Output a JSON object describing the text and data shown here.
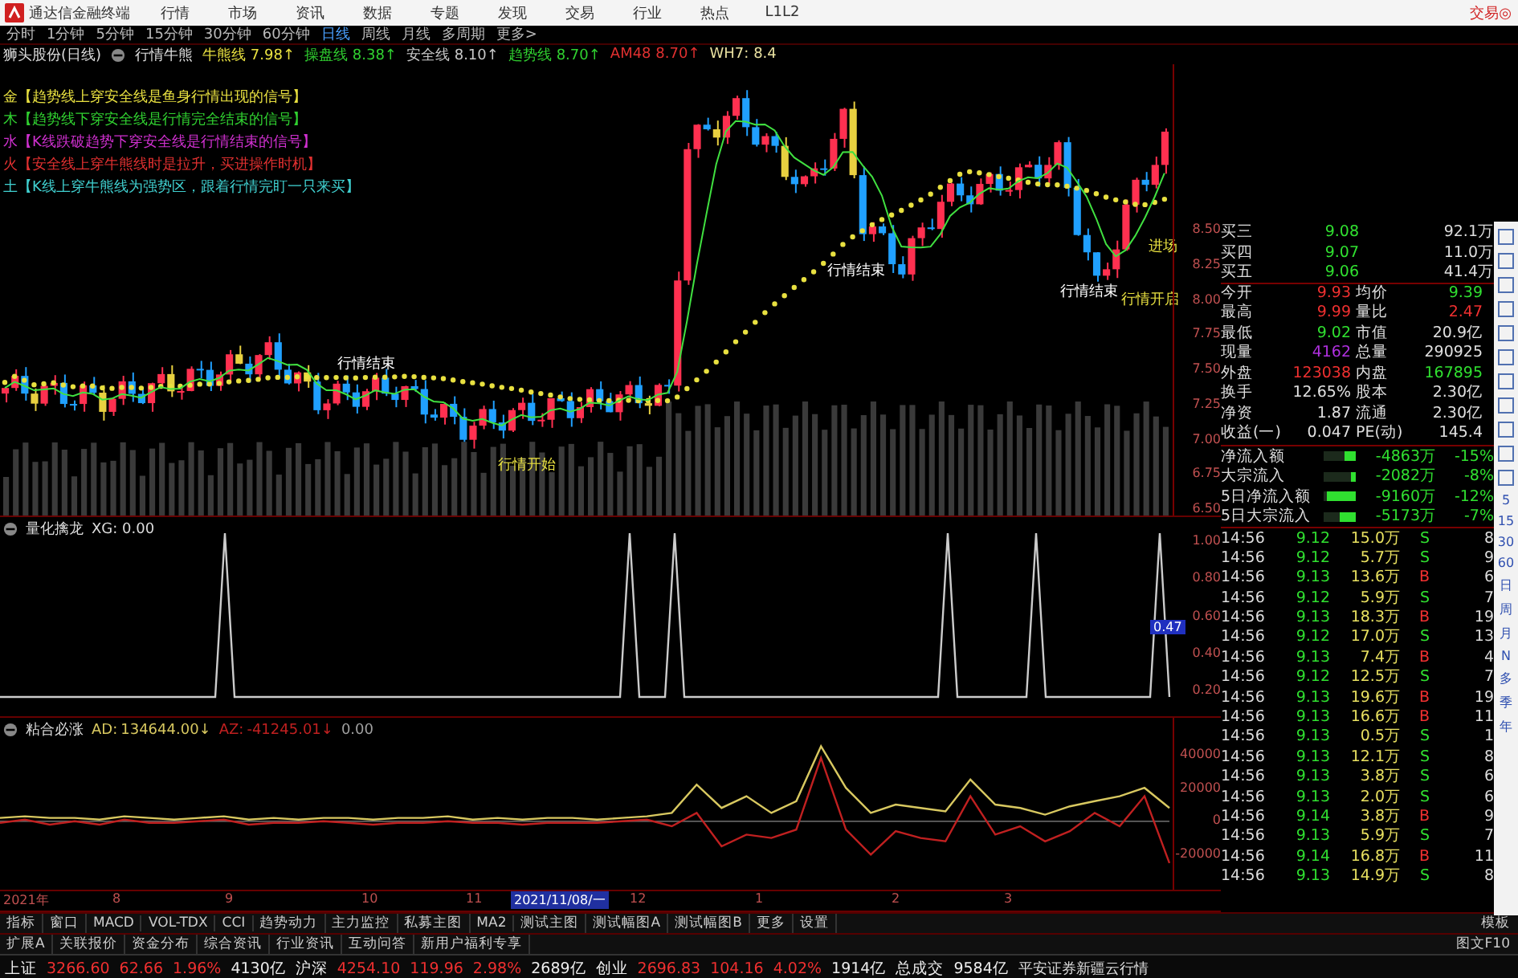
{
  "menu_bar": {
    "app_title": "通达信金融终端",
    "items": [
      "行情",
      "市场",
      "资讯",
      "数据",
      "专题",
      "发现",
      "交易",
      "行业",
      "热点",
      "L1L2"
    ],
    "trade_button": "交易◎"
  },
  "period_tabs": [
    {
      "label": "分时",
      "selected": false
    },
    {
      "label": "1分钟",
      "selected": false
    },
    {
      "label": "5分钟",
      "selected": false
    },
    {
      "label": "15分钟",
      "selected": false
    },
    {
      "label": "30分钟",
      "selected": false
    },
    {
      "label": "60分钟",
      "selected": false
    },
    {
      "label": "日线",
      "selected": true
    },
    {
      "label": "周线",
      "selected": false
    },
    {
      "label": "月线",
      "selected": false
    },
    {
      "label": "多周期",
      "selected": false
    },
    {
      "label": "更多>",
      "selected": false
    }
  ],
  "indicator_header": {
    "stock": "狮头股份(日线)",
    "formula": "行情牛熊",
    "values": [
      {
        "name": "牛熊线",
        "value": "7.98↑",
        "color": "#e8e040"
      },
      {
        "name": "操盘线",
        "value": "8.38↑",
        "color": "#30d030"
      },
      {
        "name": "安全线",
        "value": "8.10↑",
        "color": "#c8c8c8"
      },
      {
        "name": "趋势线",
        "value": "8.70↑",
        "color": "#30d030"
      },
      {
        "name": "AM48",
        "value": "8.70↑",
        "color": "#e03030"
      },
      {
        "name": "WH7:",
        "value": "8.4",
        "color": "#e8e0a0"
      }
    ]
  },
  "signal_legend": [
    {
      "text": "金【趋势线上穿安全线是鱼身行情出现的信号】",
      "color": "#e8e040"
    },
    {
      "text": "木【趋势线下穿安全线是行情完全结束的信号】",
      "color": "#30d030"
    },
    {
      "text": "水【K线跌破趋势下穿安全线是行情结束的信号】",
      "color": "#d030d0"
    },
    {
      "text": "火【安全线上穿牛熊线时是拉升，买进操作时机】",
      "color": "#e03030"
    },
    {
      "text": "土【K线上穿牛熊线为强势区，跟着行情完盯一只来买】",
      "color": "#40d0d0"
    }
  ],
  "main_chart": {
    "annotations": [
      {
        "text": "行情结束",
        "color": "#ffffff"
      },
      {
        "text": "行情开始",
        "color": "#e8e040"
      },
      {
        "text": "行情结束",
        "color": "#ffffff"
      },
      {
        "text": "行情结束",
        "color": "#ffffff"
      },
      {
        "text": "进场",
        "color": "#e8e040"
      },
      {
        "text": "行情开启",
        "color": "#e8e040"
      }
    ],
    "price_axis": [
      "8.50",
      "8.25",
      "8.00",
      "7.75",
      "7.50",
      "7.25",
      "7.00",
      "6.75",
      "6.50"
    ]
  },
  "sub_chart_1": {
    "title": "量化擒龙",
    "reading": "XG: 0.00",
    "axis": [
      "1.00",
      "0.80",
      "0.60",
      "0.40",
      "0.20"
    ],
    "marker": "0.47"
  },
  "sub_chart_2": {
    "title": "粘合必涨",
    "readings": [
      "134644.00↓",
      "-41245.01↓",
      "0.00"
    ],
    "chart_data": {
      "type": "line",
      "ylim": [
        -41000,
        62000
      ],
      "yticks": [
        40000,
        20000,
        0,
        -20000
      ],
      "series": [
        {
          "name": "AD:",
          "color": "#d8c860",
          "values": [
            2000,
            3000,
            2000,
            2000,
            1000,
            3000,
            2000,
            1000,
            2000,
            3000,
            1000,
            2000,
            1000,
            2000,
            2000,
            1000,
            2000,
            2000,
            3000,
            1000,
            2000,
            1000,
            2000,
            2000,
            1000,
            2000,
            3000,
            5000,
            22000,
            8000,
            15000,
            5000,
            12000,
            45000,
            20000,
            5000,
            10000,
            8000,
            6000,
            25000,
            10000,
            8000,
            4000,
            9000,
            12000,
            15000,
            20000,
            8000
          ]
        },
        {
          "name": "AZ:",
          "color": "#c02020",
          "values": [
            -1000,
            1000,
            -2000,
            0,
            -2000,
            1000,
            -1000,
            -1000,
            0,
            1000,
            -2000,
            -1000,
            -1000,
            0,
            -1000,
            -2000,
            -1000,
            -1000,
            0,
            -1000,
            -1000,
            -2000,
            -1000,
            -1000,
            -1000,
            0,
            1000,
            -3000,
            5000,
            -15000,
            -8000,
            -10000,
            -5000,
            38000,
            -5000,
            -20000,
            -6000,
            -10000,
            -12000,
            15000,
            -8000,
            -3000,
            -12000,
            -6000,
            5000,
            -3000,
            15000,
            -25000
          ]
        }
      ]
    }
  },
  "date_axis": [
    {
      "label": "2021年",
      "selected": false
    },
    {
      "label": "8",
      "selected": false
    },
    {
      "label": "9",
      "selected": false
    },
    {
      "label": "10",
      "selected": false
    },
    {
      "label": "11",
      "selected": false
    },
    {
      "label": "2021/11/08/一",
      "selected": true
    },
    {
      "label": "12",
      "selected": false
    },
    {
      "label": "1",
      "selected": false
    },
    {
      "label": "2",
      "selected": false
    },
    {
      "label": "3",
      "selected": false
    }
  ],
  "order_book": [
    {
      "label": "买三",
      "price": "9.08",
      "volume": "92.1万"
    },
    {
      "label": "买四",
      "price": "9.07",
      "volume": "11.0万"
    },
    {
      "label": "买五",
      "price": "9.06",
      "volume": "41.4万"
    }
  ],
  "stats": [
    {
      "label": "今开",
      "value": "9.93",
      "color": "#f03030"
    },
    {
      "label": "均价",
      "value": "9.39",
      "color": "#30e030"
    },
    {
      "label": "最高",
      "value": "9.99",
      "color": "#f03030"
    },
    {
      "label": "量比",
      "value": "2.47",
      "color": "#f03030"
    },
    {
      "label": "最低",
      "value": "9.02",
      "color": "#30e030"
    },
    {
      "label": "市值",
      "value": "20.9亿",
      "color": "#e0e0e0"
    },
    {
      "label": "现量",
      "value": "4162",
      "color": "#b030e0"
    },
    {
      "label": "总量",
      "value": "290925",
      "color": "#e0e0e0"
    },
    {
      "label": "外盘",
      "value": "123038",
      "color": "#f03030"
    },
    {
      "label": "内盘",
      "value": "167895",
      "color": "#30e030"
    },
    {
      "label": "换手",
      "value": "12.65%",
      "color": "#e0e0e0"
    },
    {
      "label": "股本",
      "value": "2.30亿",
      "color": "#e0e0e0"
    },
    {
      "label": "净资",
      "value": "1.87",
      "color": "#e0e0e0"
    },
    {
      "label": "流通",
      "value": "2.30亿",
      "color": "#e0e0e0"
    },
    {
      "label": "收益(一)",
      "value": "0.047",
      "color": "#e0e0e0"
    },
    {
      "label": "PE(动)",
      "value": "145.4",
      "color": "#e0e0e0"
    }
  ],
  "money_flow": [
    {
      "label": "净流入额",
      "level": 0.35,
      "amount": "-4863万",
      "percent": "-15%"
    },
    {
      "label": "大宗流入",
      "level": 0.15,
      "amount": "-2082万",
      "percent": "-8%"
    },
    {
      "label": "5日净流入额",
      "level": 0.9,
      "amount": "-9160万",
      "percent": "-12%"
    },
    {
      "label": "5日大宗流入",
      "level": 0.5,
      "amount": "-5173万",
      "percent": "-7%"
    }
  ],
  "ticks": [
    {
      "time": "14:56",
      "price": "9.12",
      "volume": "15.0万",
      "side": "S",
      "kind": "sell",
      "column_5": "8"
    },
    {
      "time": "14:56",
      "price": "9.12",
      "volume": "5.7万",
      "side": "S",
      "kind": "sell",
      "column_5": "9"
    },
    {
      "time": "14:56",
      "price": "9.13",
      "volume": "13.6万",
      "side": "B",
      "kind": "buy",
      "column_5": "6"
    },
    {
      "time": "14:56",
      "price": "9.12",
      "volume": "5.9万",
      "side": "S",
      "kind": "sell",
      "column_5": "7"
    },
    {
      "time": "14:56",
      "price": "9.13",
      "volume": "18.3万",
      "side": "B",
      "kind": "buy",
      "column_5": "19"
    },
    {
      "time": "14:56",
      "price": "9.12",
      "volume": "17.0万",
      "side": "S",
      "kind": "sell",
      "column_5": "13"
    },
    {
      "time": "14:56",
      "price": "9.13",
      "volume": "7.4万",
      "side": "B",
      "kind": "buy",
      "column_5": "4"
    },
    {
      "time": "14:56",
      "price": "9.12",
      "volume": "12.5万",
      "side": "S",
      "kind": "sell",
      "column_5": "7"
    },
    {
      "time": "14:56",
      "price": "9.13",
      "volume": "19.6万",
      "side": "B",
      "kind": "buy",
      "column_5": "19"
    },
    {
      "time": "14:56",
      "price": "9.13",
      "volume": "16.6万",
      "side": "B",
      "kind": "buy",
      "column_5": "11"
    },
    {
      "time": "14:56",
      "price": "9.13",
      "volume": "0.5万",
      "side": "S",
      "kind": "sell",
      "column_5": "1"
    },
    {
      "time": "14:56",
      "price": "9.13",
      "volume": "12.1万",
      "side": "S",
      "kind": "sell",
      "column_5": "8"
    },
    {
      "time": "14:56",
      "price": "9.13",
      "volume": "3.8万",
      "side": "S",
      "kind": "sell",
      "column_5": "6"
    },
    {
      "time": "14:56",
      "price": "9.13",
      "volume": "2.0万",
      "side": "S",
      "kind": "sell",
      "column_5": "6"
    },
    {
      "time": "14:56",
      "price": "9.14",
      "volume": "3.8万",
      "side": "B",
      "kind": "buy",
      "column_5": "9"
    },
    {
      "time": "14:56",
      "price": "9.13",
      "volume": "5.9万",
      "side": "S",
      "kind": "sell",
      "column_5": "7"
    },
    {
      "time": "14:56",
      "price": "9.14",
      "volume": "16.8万",
      "side": "B",
      "kind": "buy",
      "column_5": "11"
    },
    {
      "time": "14:56",
      "price": "9.13",
      "volume": "14.9万",
      "side": "S",
      "kind": "sell",
      "column_5": "8"
    }
  ],
  "side_strip": [
    "5",
    "15",
    "30",
    "60",
    "日",
    "周",
    "月",
    "N",
    "多",
    "季",
    "年"
  ],
  "indicator_tabs": [
    "指标",
    "窗口",
    "MACD",
    "VOL-TDX",
    "CCI",
    "趋势动力",
    "主力监控",
    "私募主图",
    "MA2",
    "测试主图",
    "测试幅图A",
    "测试幅图B",
    "更多",
    "设置"
  ],
  "template_button": "模板",
  "info_tabs": [
    "扩展A",
    "关联报价",
    "资金分布",
    "综合资讯",
    "行业资讯",
    "互动问答",
    "新用户福利专享"
  ],
  "f10_button": "图文F10",
  "status_bar": [
    {
      "label": "上证",
      "price": "3266.60",
      "change": "62.66",
      "percent": "1.96%",
      "turnover": "4130亿"
    },
    {
      "label": "沪深",
      "price": "4254.10",
      "change": "119.96",
      "percent": "2.98%",
      "turnover": "2689亿"
    },
    {
      "label": "创业",
      "price": "2696.83",
      "change": "104.16",
      "percent": "4.02%",
      "turnover": "1914亿"
    }
  ],
  "total_turnover": {
    "label": "总成交",
    "value": "9584亿"
  },
  "status_note": "平安证券新疆云行情"
}
